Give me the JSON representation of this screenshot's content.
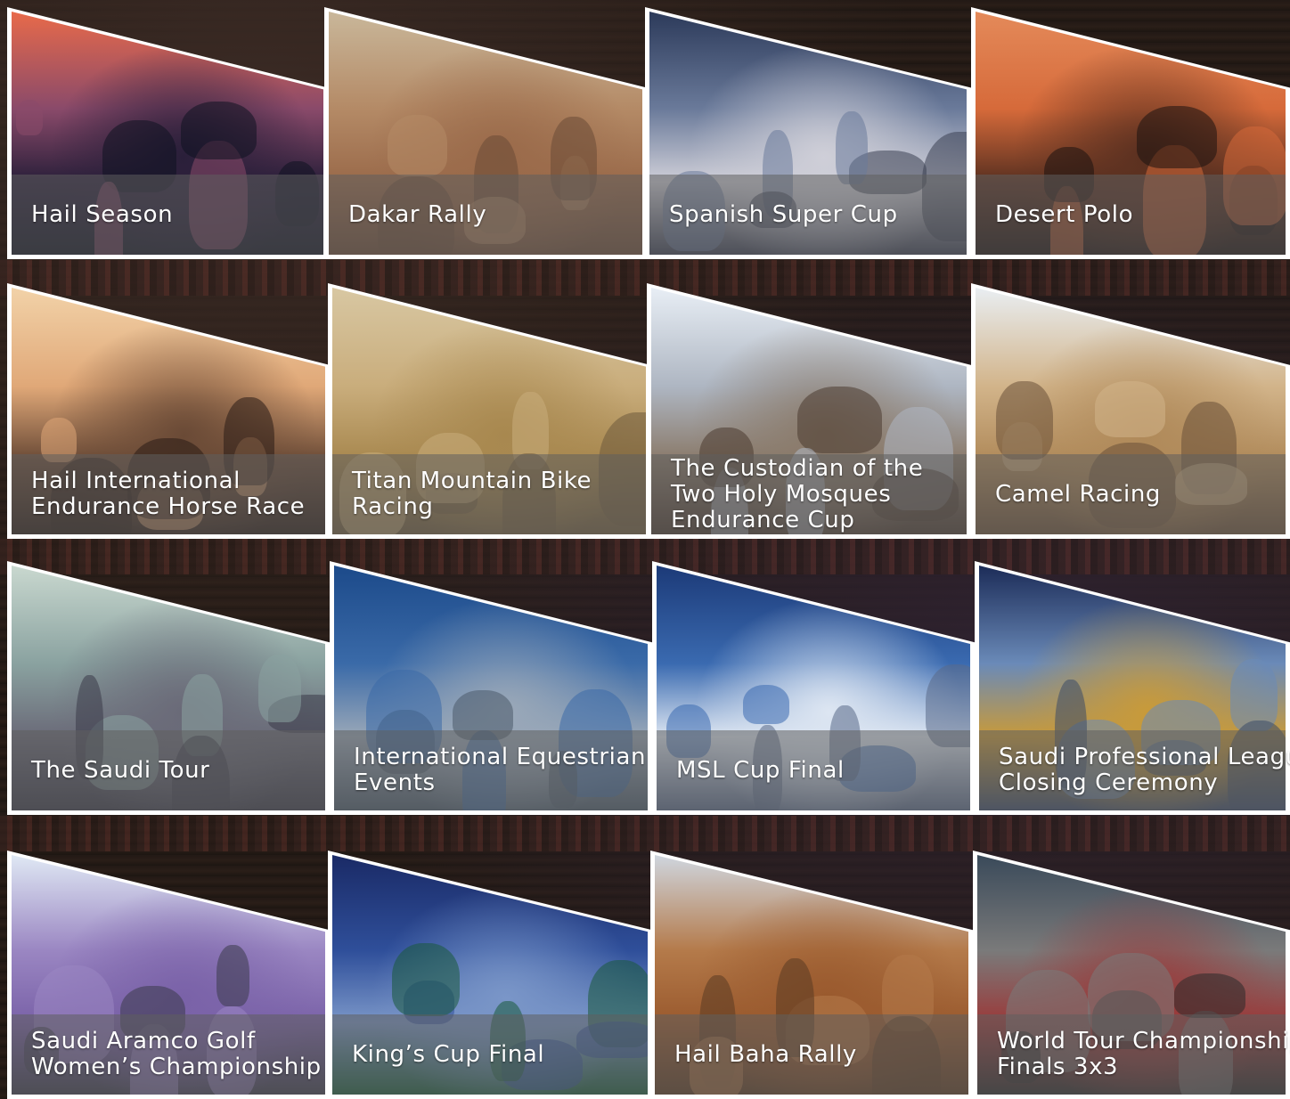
{
  "tiles": [
    {
      "label_lines": [
        "Hail Season"
      ],
      "scene": "desert-city-sunset"
    },
    {
      "label_lines": [
        "Dakar Rally"
      ],
      "scene": "rally-car-dunes"
    },
    {
      "label_lines": [
        "Spanish Super Cup"
      ],
      "scene": "trophy-celebration"
    },
    {
      "label_lines": [
        "Desert Polo"
      ],
      "scene": "polo-horses-sunset"
    },
    {
      "label_lines": [
        "Hail International",
        "Endurance Horse Race"
      ],
      "scene": "horse-rider-silhouette"
    },
    {
      "label_lines": [
        "Titan Mountain Bike",
        "Racing"
      ],
      "scene": "mountain-bikers-desert"
    },
    {
      "label_lines": [
        "The Custodian of the",
        "Two Holy Mosques",
        "Endurance Cup"
      ],
      "scene": "endurance-rider-canyon"
    },
    {
      "label_lines": [
        "Camel Racing"
      ],
      "scene": "camel-race-track"
    },
    {
      "label_lines": [
        "The Saudi Tour"
      ],
      "scene": "cycling-peloton"
    },
    {
      "label_lines": [
        "International Equestrian",
        "Events"
      ],
      "scene": "show-jumping"
    },
    {
      "label_lines": [
        "MSL Cup Final"
      ],
      "scene": "football-team-celebration"
    },
    {
      "label_lines": [
        "Saudi Professional League",
        "Closing Ceremony"
      ],
      "scene": "league-closing-ceremony"
    },
    {
      "label_lines": [
        "Saudi Aramco Golf",
        "Women’s Championship"
      ],
      "scene": "golfer-aramco-board"
    },
    {
      "label_lines": [
        "King’s Cup Final"
      ],
      "scene": "kings-cup-celebration"
    },
    {
      "label_lines": [
        "Hail Baha Rally"
      ],
      "scene": "helicopter-desert"
    },
    {
      "label_lines": [
        "World Tour Championship",
        "Finals 3x3"
      ],
      "scene": "basketball-3x3"
    }
  ]
}
